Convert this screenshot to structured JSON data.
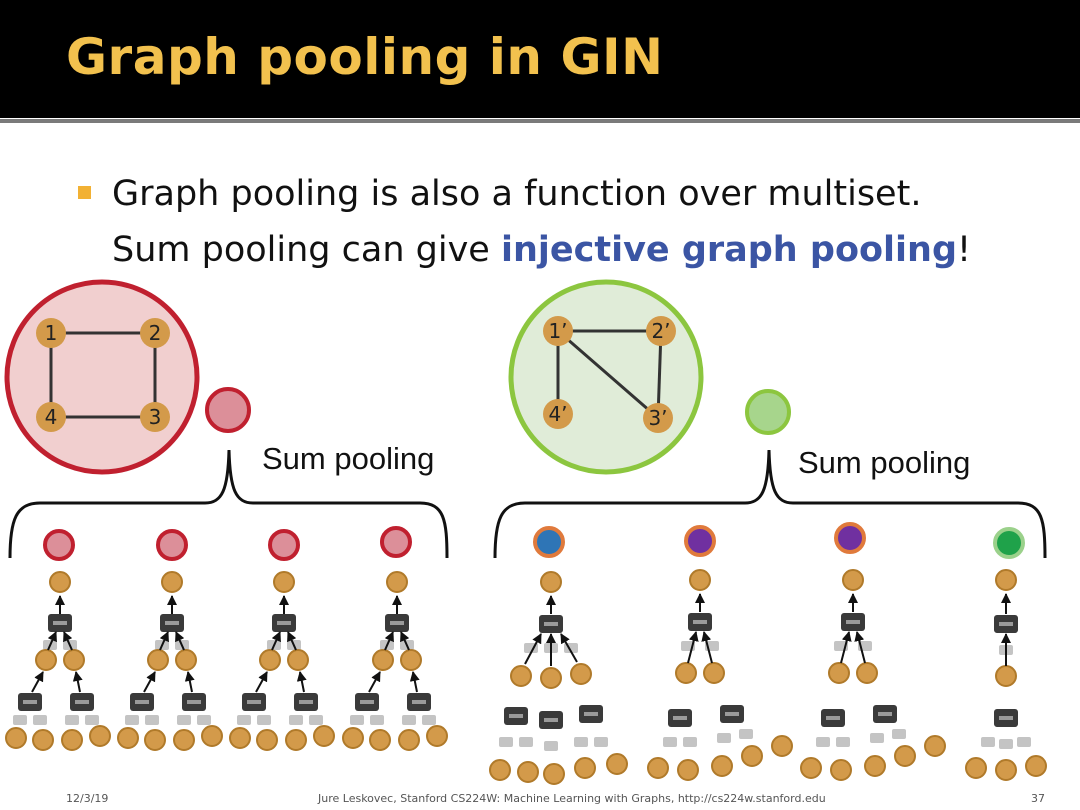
{
  "slide": {
    "title": "Graph pooling in GIN",
    "bullet": {
      "line1": "Graph pooling is also a function over multiset.",
      "line2_prefix": "Sum pooling can give ",
      "line2_highlight": "injective graph pooling",
      "line2_suffix": "!"
    },
    "left_graph": {
      "nodes": [
        "1",
        "2",
        "3",
        "4"
      ],
      "edges": [
        [
          "1",
          "2"
        ],
        [
          "2",
          "3"
        ],
        [
          "3",
          "4"
        ],
        [
          "4",
          "1"
        ]
      ]
    },
    "right_graph": {
      "nodes": [
        "1’",
        "2’",
        "3’",
        "4’"
      ],
      "edges": [
        [
          "1’",
          "2’"
        ],
        [
          "1’",
          "3’"
        ],
        [
          "1’",
          "4’"
        ],
        [
          "2’",
          "3’"
        ]
      ]
    },
    "left_pool_label": "Sum pooling",
    "right_pool_label": "Sum pooling",
    "footer": {
      "date": "12/3/19",
      "credit": "Jure Leskovec, Stanford CS224W: Machine Learning with Graphs, http://cs224w.stanford.edu",
      "page": "37"
    },
    "colors": {
      "title": "#f2c14e",
      "highlight": "#3b55a4",
      "node_fill": "#d39a4a",
      "left_circle_stroke": "#c0202f",
      "left_circle_fill": "#f1cfcf",
      "right_circle_stroke": "#8cc63f",
      "right_circle_fill": "#e0ecd8",
      "left_pooled": "#dc8f99",
      "right_pooled": "#a7d58c",
      "emb_pink": "#dc8f99",
      "emb_blue": "#2e75b6",
      "emb_purple": "#7030a0",
      "emb_green": "#1fa24a"
    }
  }
}
